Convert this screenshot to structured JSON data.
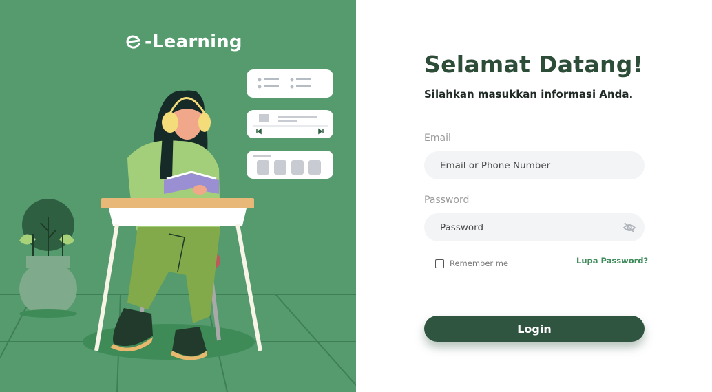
{
  "brand": {
    "logo_text": "-Learning",
    "logo_icon": "e-letter-logo-icon",
    "panel_color": "#559b6e"
  },
  "welcome": {
    "title": "Selamat Datang!",
    "subtitle": "Silahkan masukkan informasi Anda."
  },
  "form": {
    "email_label": "Email",
    "email_placeholder": "Email or Phone Number",
    "password_label": "Password",
    "password_placeholder": "Password",
    "password_toggle_icon": "eye-slash-icon",
    "remember_label": "Remember me",
    "remember_checked": false,
    "forgot_label": "Lupa Password?",
    "login_label": "Login"
  },
  "colors": {
    "primary_dark": "#2f5440",
    "title_color": "#2d4d38",
    "link_color": "#3e8a5a",
    "field_bg": "#f3f4f6"
  }
}
